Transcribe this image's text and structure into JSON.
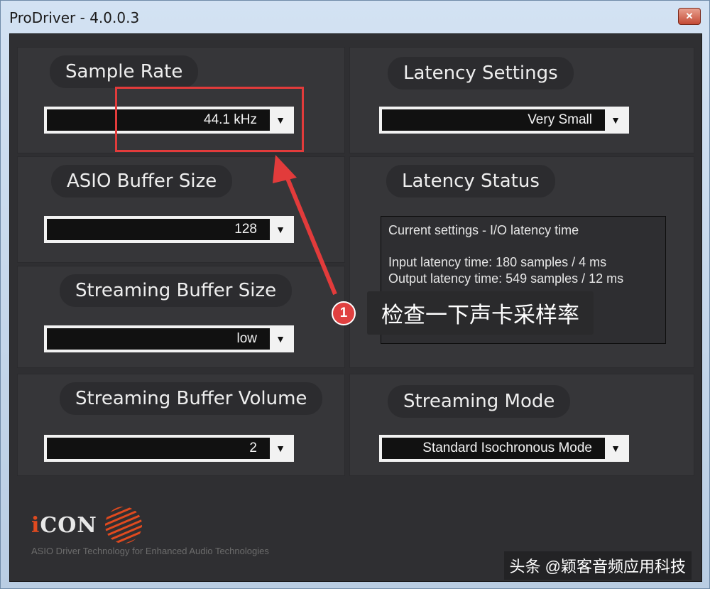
{
  "window": {
    "title": "ProDriver - 4.0.0.3",
    "close_label": "✕"
  },
  "left": {
    "sample_rate": {
      "label": "Sample Rate",
      "value": "44.1 kHz"
    },
    "asio_buffer": {
      "label": "ASIO Buffer Size",
      "value": "128"
    },
    "stream_buffer_size": {
      "label": "Streaming Buffer Size",
      "value": "low"
    },
    "stream_buffer_volume": {
      "label": "Streaming Buffer Volume",
      "value": "2"
    }
  },
  "right": {
    "latency_settings": {
      "label": "Latency Settings",
      "value": "Very Small"
    },
    "latency_status": {
      "label": "Latency Status",
      "heading": "Current settings - I/O latency time",
      "input": "Input latency time: 180 samples / 4 ms",
      "output": "Output latency time: 549 samples / 12 ms"
    },
    "streaming_mode": {
      "label": "Streaming Mode",
      "value": "Standard Isochronous Mode"
    }
  },
  "annotation": {
    "number": "1",
    "text": "检查一下声卡采样率",
    "color": "#e23b3b"
  },
  "logo": {
    "brand_i": "i",
    "brand_rest": "CON",
    "subtitle": "ASIO Driver Technology for Enhanced Audio Technologies"
  },
  "watermark": "头条 @颖客音频应用科技",
  "colors": {
    "background": "#2f2f32",
    "panel": "#363639",
    "accent": "#e23b3b"
  }
}
